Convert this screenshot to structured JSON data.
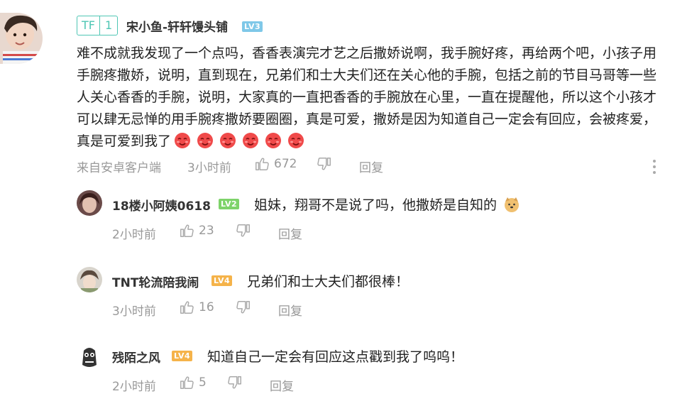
{
  "main_comment": {
    "badge_tag": "TF",
    "badge_num": "1",
    "username": "宋小鱼-轩轩馒头铺",
    "level": "LV3",
    "text": "难不成就我发现了一个点吗，香香表演完才艺之后撒娇说啊，我手腕好疼，再给两个吧，小孩子用手腕疼撒娇，说明，直到现在，兄弟们和士大夫们还在关心他的手腕，包括之前的节目马哥等一些人关心香香的手腕，说明，大家真的一直把香香的手腕放在心里，一直在提醒他，所以这个小孩才可以肆无忌惮的用手腕疼撒娇要圈圈，真是可爱，撒娇是因为知道自己一定会有回应，会被疼爱，真是可爱到我了",
    "source": "来自安卓客户端",
    "time": "3小时前",
    "likes": "672",
    "reply_label": "回复",
    "emoji_count": 6
  },
  "replies": [
    {
      "username": "18楼小阿姨0618",
      "level": "LV2",
      "level_color": "#7ed36a",
      "text": "姐妹，翔哥不是说了吗，他撒娇是自知的",
      "time": "2小时前",
      "likes": "23",
      "reply_label": "回复"
    },
    {
      "username": "TNT轮流陪我闹",
      "level": "LV4",
      "level_color": "#f5b34a",
      "text": "兄弟们和士大夫们都很棒！",
      "time": "3小时前",
      "likes": "16",
      "reply_label": "回复"
    },
    {
      "username": "残陌之风",
      "level": "LV4",
      "level_color": "#f5b34a",
      "text": "知道自己一定会有回应这点戳到我了呜呜！",
      "time": "2小时前",
      "likes": "5",
      "reply_label": "回复"
    }
  ],
  "icons": {
    "like": "thumbs-up-icon",
    "dislike": "thumbs-down-icon",
    "more": "more-vertical-icon",
    "emoji_red": "red-face-emoji-icon",
    "emoji_doge": "doge-emoji-icon"
  },
  "colors": {
    "tf_badge": "#4fc6b4",
    "lv3": "#7fc8e8",
    "meta": "#999999"
  }
}
